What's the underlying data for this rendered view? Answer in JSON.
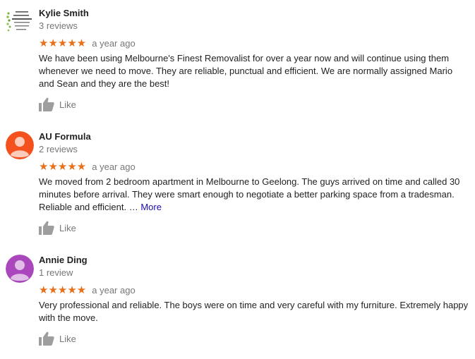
{
  "reviews": [
    {
      "name": "Kylie Smith",
      "count": "3 reviews",
      "stars": "★★★★★",
      "time": "a year ago",
      "text": "We have been using Melbourne's Finest Removalist for over a year now and will continue using them whenever we need to move. They are reliable, punctual and efficient. We are normally assigned Mario and Sean and they are the best!",
      "like": "Like",
      "avatar_lines": [
        "& MORE",
        "and ALWAYS",
        "living with ATTENTION",
        "perfectly stylish",
        "and connected",
        "with nature"
      ]
    },
    {
      "name": "AU Formula",
      "count": "2 reviews",
      "stars": "★★★★★",
      "time": "a year ago",
      "text": "We moved from 2 bedroom apartment in Melbourne to Geelong. The guys arrived on time and called 30 minutes before arrival. They were smart enough to negotiate a better parking space from a tradesman. Reliable and efficient.",
      "ellipsis": " … ",
      "more": "More",
      "like": "Like",
      "avatar_color": "#f4511e"
    },
    {
      "name": "Annie Ding",
      "count": "1 review",
      "stars": "★★★★★",
      "time": "a year ago",
      "text": "Very professional and reliable. The boys were on time and very careful with my furniture. Extremely happy with the move.",
      "like": "Like",
      "avatar_color": "#ab47bc"
    }
  ],
  "colors": {
    "star": "#e7711b",
    "link": "#1a0dab",
    "muted": "#777777"
  },
  "icons": [
    "thumbs-up-icon",
    "person-avatar-icon"
  ]
}
